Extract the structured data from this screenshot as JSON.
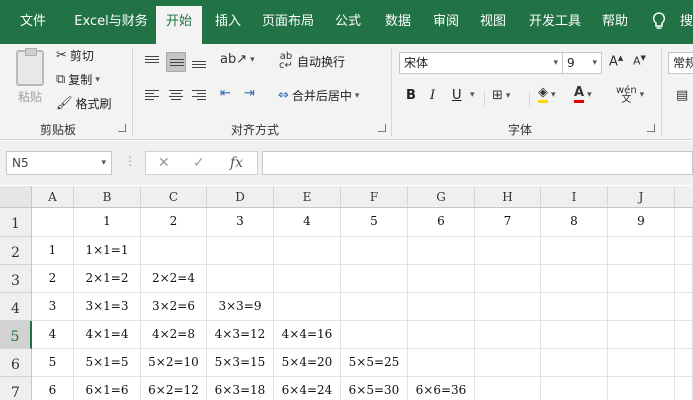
{
  "tabs": [
    {
      "label": "文件",
      "active": false
    },
    {
      "label": "Excel与财务",
      "active": false
    },
    {
      "label": "开始",
      "active": true
    },
    {
      "label": "插入",
      "active": false
    },
    {
      "label": "页面布局",
      "active": false
    },
    {
      "label": "公式",
      "active": false
    },
    {
      "label": "数据",
      "active": false
    },
    {
      "label": "审阅",
      "active": false
    },
    {
      "label": "视图",
      "active": false
    },
    {
      "label": "开发工具",
      "active": false
    },
    {
      "label": "帮助",
      "active": false
    }
  ],
  "tab_overflow": "搜",
  "ribbon": {
    "clipboard": {
      "paste": "粘贴",
      "cut": "剪切",
      "copy": "复制",
      "format_painter": "格式刷",
      "group_label": "剪贴板"
    },
    "alignment": {
      "wrap_text": "自动换行",
      "merge_center": "合并后居中",
      "group_label": "对齐方式"
    },
    "font": {
      "font_name": "宋体",
      "font_size": "9",
      "bold": "B",
      "italic": "I",
      "underline": "U",
      "font_color_glyph": "A",
      "group_label": "字体",
      "accent_red": "#e00000",
      "accent_yellow": "#ffd700"
    },
    "number": {
      "format": "常规"
    }
  },
  "formula_bar": {
    "name_box": "N5",
    "cancel": "✕",
    "enter": "✓",
    "fx": "fx",
    "formula": ""
  },
  "sheet": {
    "columns": [
      "A",
      "B",
      "C",
      "D",
      "E",
      "F",
      "G",
      "H",
      "I",
      "J"
    ],
    "rows": [
      "1",
      "2",
      "3",
      "4",
      "5",
      "6",
      "7"
    ],
    "selected_row": "5",
    "cells": [
      [
        "",
        "1",
        "2",
        "3",
        "4",
        "5",
        "6",
        "7",
        "8",
        "9"
      ],
      [
        "1",
        "1×1=1",
        "",
        "",
        "",
        "",
        "",
        "",
        "",
        ""
      ],
      [
        "2",
        "2×1=2",
        "2×2=4",
        "",
        "",
        "",
        "",
        "",
        "",
        ""
      ],
      [
        "3",
        "3×1=3",
        "3×2=6",
        "3×3=9",
        "",
        "",
        "",
        "",
        "",
        ""
      ],
      [
        "4",
        "4×1=4",
        "4×2=8",
        "4×3=12",
        "4×4=16",
        "",
        "",
        "",
        "",
        ""
      ],
      [
        "5",
        "5×1=5",
        "5×2=10",
        "5×3=15",
        "5×4=20",
        "5×5=25",
        "",
        "",
        "",
        ""
      ],
      [
        "6",
        "6×1=6",
        "6×2=12",
        "6×3=18",
        "6×4=24",
        "6×5=30",
        "6×6=36",
        "",
        "",
        ""
      ]
    ]
  },
  "colors": {
    "brand": "#217346",
    "ribbon_bg": "#f3f3f3"
  }
}
